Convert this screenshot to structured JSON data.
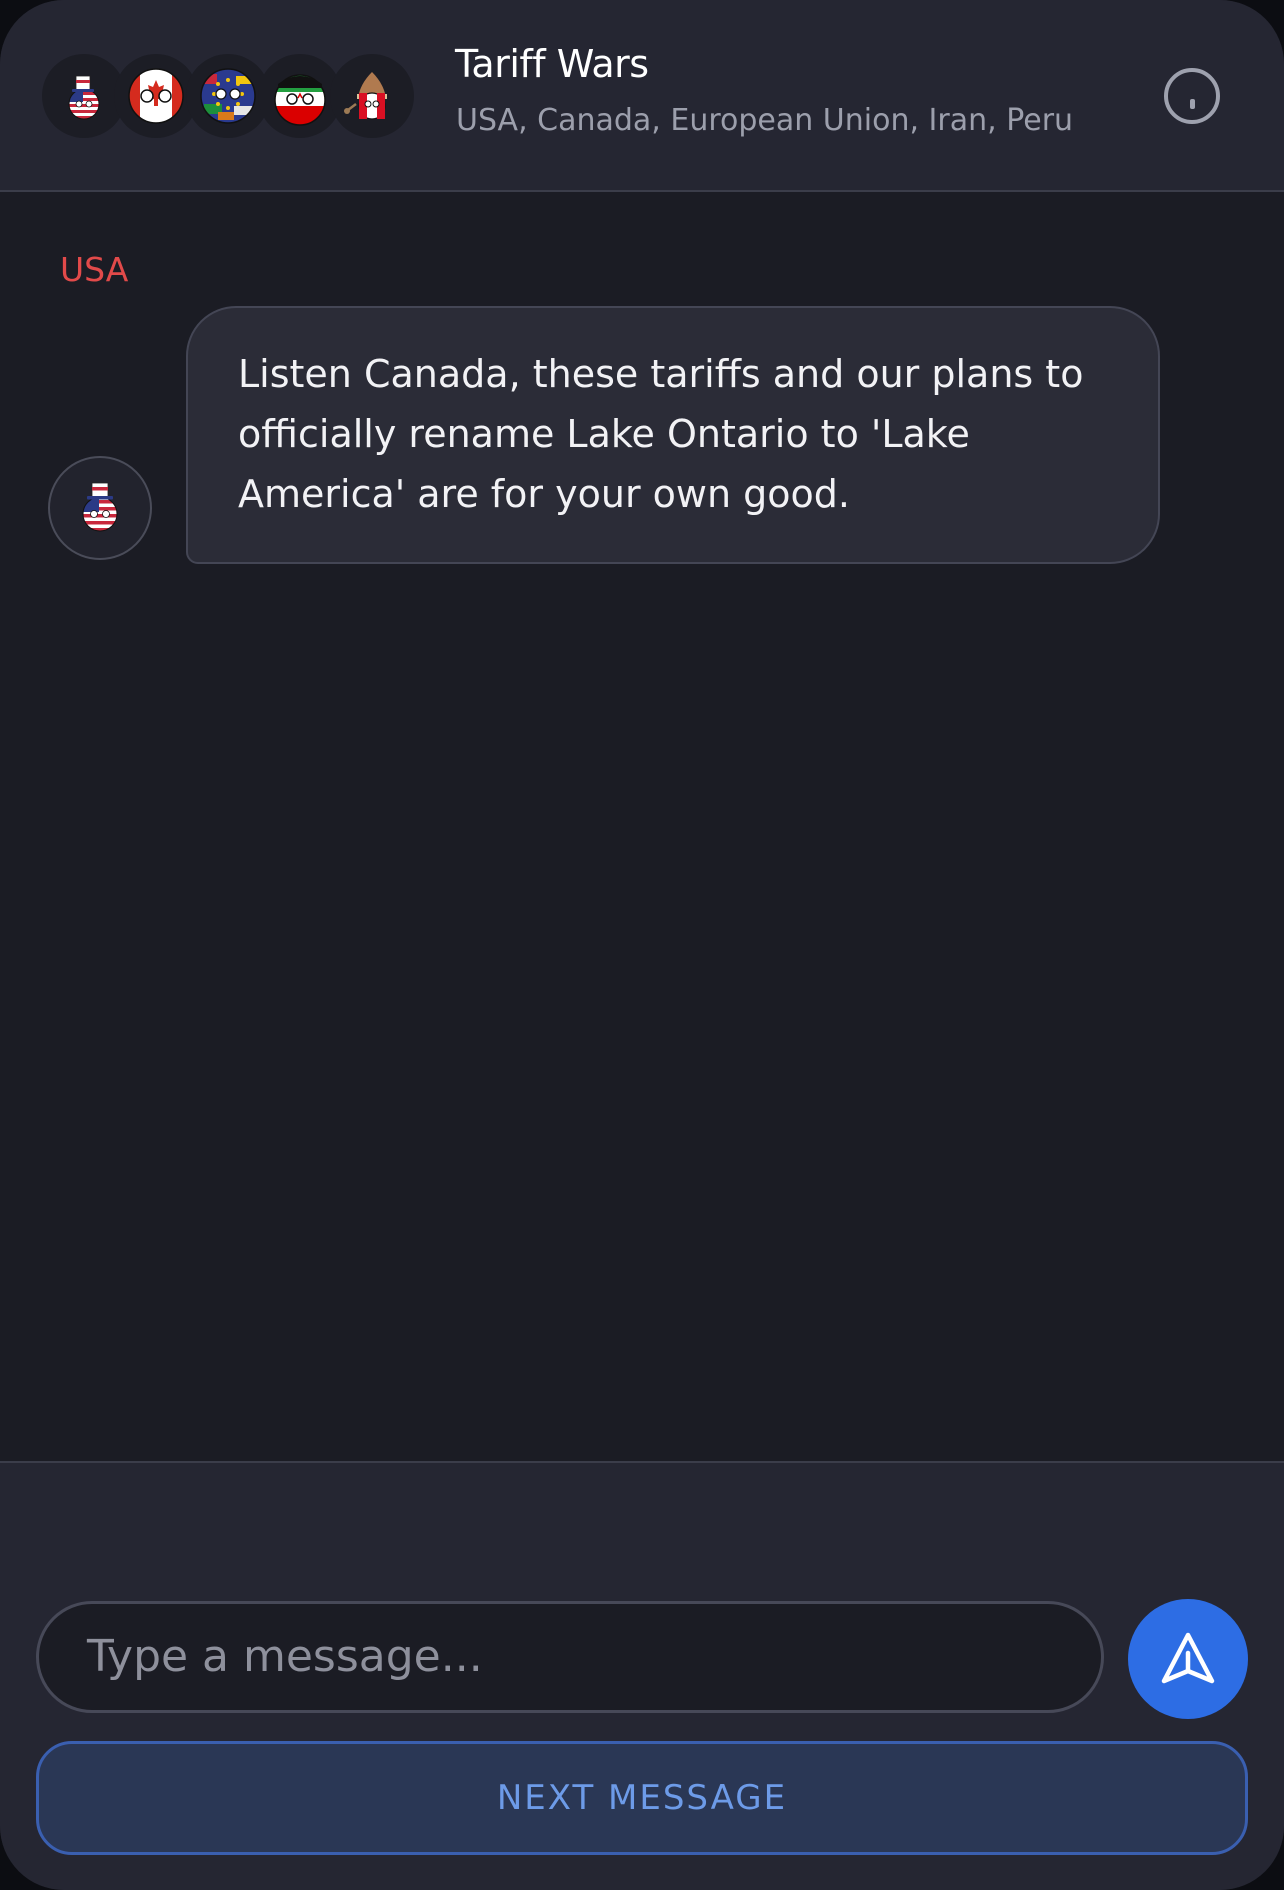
{
  "header": {
    "title": "Tariff Wars",
    "participants": "USA, Canada, European Union, Iran, Peru",
    "avatars": [
      "usa-ball-icon",
      "canada-ball-icon",
      "eu-ball-icon",
      "iran-ball-icon",
      "peru-ball-icon"
    ],
    "info_icon": "info-icon"
  },
  "messages": [
    {
      "sender": "USA",
      "sender_color": "#e24a4a",
      "avatar": "usa-ball-icon",
      "text": "Listen Canada, these tariffs and our plans to officially rename Lake Ontario to 'Lake America' are for your own good."
    }
  ],
  "composer": {
    "placeholder": "Type a message...",
    "send_icon": "send-icon",
    "next_label": "NEXT MESSAGE"
  },
  "colors": {
    "accent": "#2d6de4",
    "background": "#1b1c24",
    "header_bg": "#252632"
  }
}
